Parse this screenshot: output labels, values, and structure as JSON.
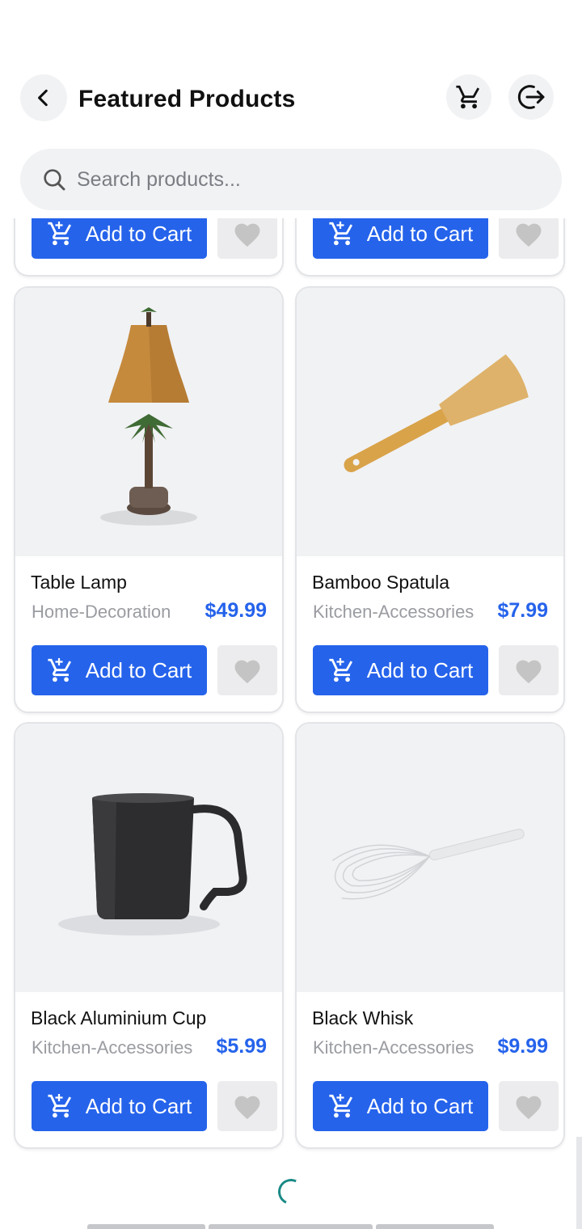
{
  "header": {
    "title": "Featured Products",
    "back_icon": "chevron-left-icon",
    "cart_icon": "cart-icon",
    "logout_icon": "logout-icon"
  },
  "search": {
    "placeholder": "Search products...",
    "value": ""
  },
  "colors": {
    "accent": "#2563eb",
    "price": "#2563eb",
    "favorite_icon": "#c4c4c4",
    "spinner": "#1a8a86"
  },
  "partial_cards": [
    {
      "add_label": "Add to Cart"
    },
    {
      "add_label": "Add to Cart"
    }
  ],
  "products": [
    {
      "name": "Table Lamp",
      "category": "Home-Decoration",
      "price": "$49.99",
      "add_label": "Add to Cart",
      "image_icon": "table-lamp-image"
    },
    {
      "name": "Bamboo Spatula",
      "category": "Kitchen-Accessories",
      "price": "$7.99",
      "add_label": "Add to Cart",
      "image_icon": "bamboo-spatula-image"
    },
    {
      "name": "Black Aluminium Cup",
      "category": "Kitchen-Accessories",
      "price": "$5.99",
      "add_label": "Add to Cart",
      "image_icon": "black-cup-image"
    },
    {
      "name": "Black Whisk",
      "category": "Kitchen-Accessories",
      "price": "$9.99",
      "add_label": "Add to Cart",
      "image_icon": "whisk-image"
    }
  ]
}
